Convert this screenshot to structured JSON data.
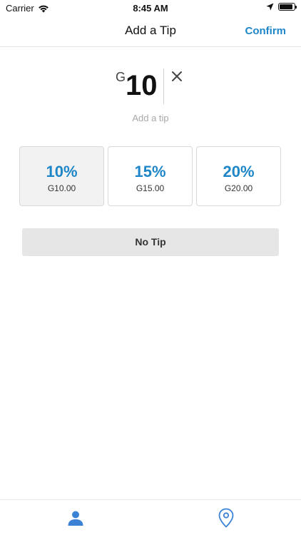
{
  "status_bar": {
    "carrier": "Carrier",
    "time": "8:45 AM",
    "battery_level": 0.9
  },
  "nav": {
    "title": "Add a Tip",
    "confirm_label": "Confirm"
  },
  "amount": {
    "currency": "G",
    "value": "10",
    "hint": "Add a tip"
  },
  "options": [
    {
      "percent": "10%",
      "amount": "G10.00",
      "selected": true
    },
    {
      "percent": "15%",
      "amount": "G15.00",
      "selected": false
    },
    {
      "percent": "20%",
      "amount": "G20.00",
      "selected": false
    }
  ],
  "no_tip_label": "No Tip",
  "tab_bar": {
    "items": [
      {
        "icon": "person-icon",
        "active": true
      },
      {
        "icon": "location-pin-icon",
        "active": false
      }
    ]
  },
  "colors": {
    "accent": "#1f86c8",
    "selected_bg": "#f2f2f2",
    "no_tip_bg": "#e6e6e6",
    "hint": "#a8a8a8"
  }
}
